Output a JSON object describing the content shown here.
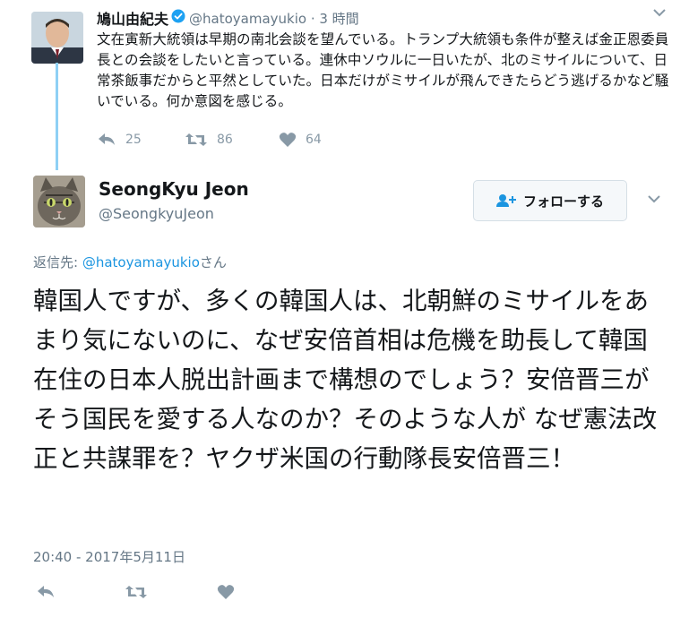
{
  "parent_tweet": {
    "display_name": "鳩山由紀夫",
    "handle": "@hatoyamayukio",
    "time": "· 3 時間",
    "text": "文在寅新大統領は早期の南北会談を望んでいる。トランプ大統領も条件が整えば金正恩委員長との会談をしたいと言っている。連休中ソウルに一日いたが、北のミサイルについて、日常茶飯事だからと平然としていた。日本だけがミサイルが飛んできたらどう逃げるかなど騒いでいる。何か意図を感じる。",
    "reply_count": "25",
    "retweet_count": "86",
    "like_count": "64"
  },
  "main_tweet": {
    "display_name": "SeongKyu Jeon",
    "handle": "@SeongkyuJeon",
    "follow_label": "フォローする",
    "reply_prefix": "返信先: ",
    "reply_handle": "@hatoyamayukio",
    "reply_suffix": "さん",
    "text": "韓国人ですが、多くの韓国人は、北朝鮮のミサイルをあまり気にないのに、なぜ安倍首相は危機を助長して韓国在住の日本人脱出計画まで構想のでしょう？安倍晋三がそう国民を愛する人なのか？そのような人が なぜ憲法改正と共謀罪を？ヤクザ米国の行動隊長安倍晋三！",
    "timestamp": "20:40 - 2017年5月11日"
  },
  "colors": {
    "accent": "#1b95e0",
    "muted": "#657786",
    "icon": "#8899a6",
    "thread_line": "#8ed0f5"
  },
  "icons": [
    "chevron-down-icon",
    "verified-badge-icon",
    "reply-icon",
    "retweet-icon",
    "like-icon",
    "follow-user-icon"
  ]
}
